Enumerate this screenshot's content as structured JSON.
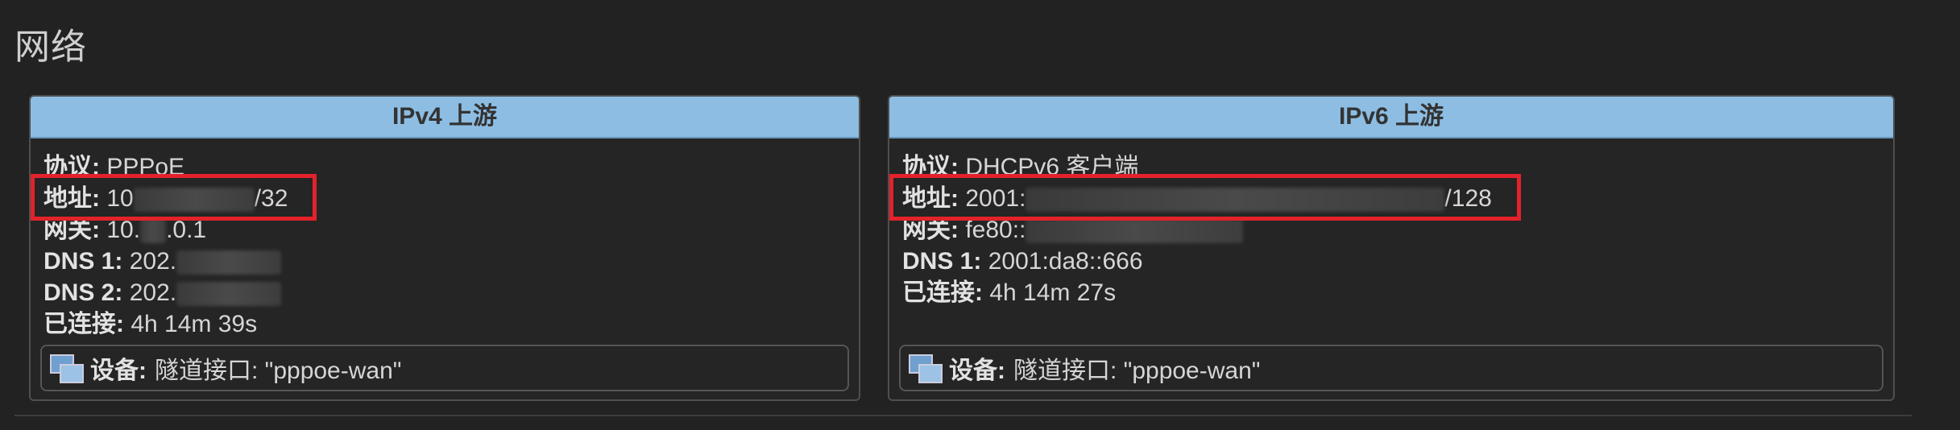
{
  "section": {
    "title": "网络"
  },
  "ipv4": {
    "header": "IPv4 上游",
    "protocol_label": "协议:",
    "protocol_value": "PPPoE",
    "address_label": "地址:",
    "address_prefix": "10",
    "address_suffix": "/32",
    "gateway_label": "网关:",
    "gateway_prefix": "10.",
    "gateway_suffix": ".0.1",
    "dns1_label": "DNS 1:",
    "dns1_value": "202.",
    "dns2_label": "DNS 2:",
    "dns2_value": "202.",
    "connected_label": "已连接:",
    "connected_value": "4h 14m 39s",
    "device_label": "设备:",
    "device_value": "隧道接口: \"pppoe-wan\""
  },
  "ipv6": {
    "header": "IPv6 上游",
    "protocol_label": "协议:",
    "protocol_value": "DHCPv6 客户端",
    "address_label": "地址:",
    "address_prefix": "2001:",
    "address_suffix": "/128",
    "gateway_label": "网关:",
    "gateway_prefix": "fe80::",
    "dns1_label": "DNS 1:",
    "dns1_value": "2001:da8::666",
    "connected_label": "已连接:",
    "connected_value": "4h 14m 27s",
    "device_label": "设备:",
    "device_value": "隧道接口: \"pppoe-wan\""
  },
  "colors": {
    "header_bg": "#8dbde2",
    "highlight": "#e3222b",
    "background": "#222222"
  }
}
